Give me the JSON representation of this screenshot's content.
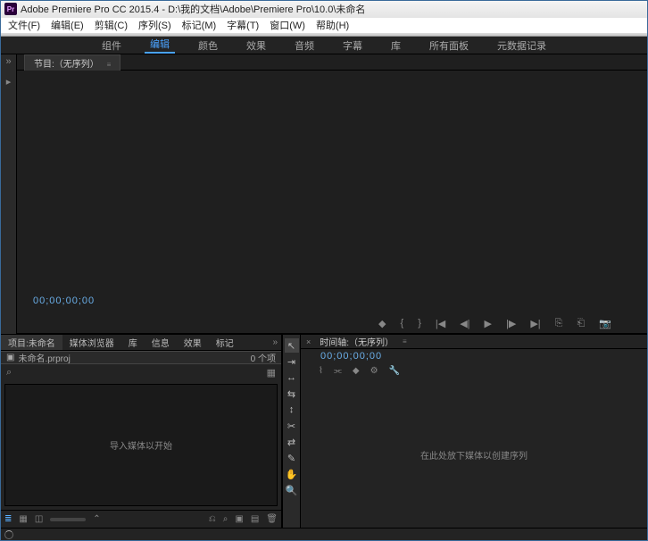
{
  "titlebar": {
    "app_icon": "Pr",
    "title": "Adobe Premiere Pro CC 2015.4 - D:\\我的文档\\Adobe\\Premiere Pro\\10.0\\未命名"
  },
  "menubar": {
    "items": [
      "文件(F)",
      "编辑(E)",
      "剪辑(C)",
      "序列(S)",
      "标记(M)",
      "字幕(T)",
      "窗口(W)",
      "帮助(H)"
    ]
  },
  "workspaces": {
    "items": [
      "组件",
      "编辑",
      "颜色",
      "效果",
      "音频",
      "字幕",
      "库",
      "所有面板",
      "元数据记录"
    ],
    "active_index": 1,
    "overflow": "»"
  },
  "program_panel": {
    "tab_label": "节目:（无序列）",
    "tab_menu_glyph": "≡",
    "timecode": "00;00;00;00",
    "controls": [
      "tag-icon",
      "in-bracket",
      "out-bracket",
      "go-start",
      "step-back",
      "play",
      "step-fwd",
      "go-end",
      "lift",
      "extract",
      "export-frame"
    ]
  },
  "left_strip": {
    "handle": "»",
    "marker": "▸"
  },
  "project_panel": {
    "tabs": [
      "项目:未命名",
      "媒体浏览器",
      "库",
      "信息",
      "效果",
      "标记"
    ],
    "active_tab": 0,
    "overflow": "»",
    "file_name": "未命名.prproj",
    "item_count": "0 个项",
    "search_glyph": "⌕",
    "folder_glyph": "▦",
    "bin_message": "导入媒体以开始",
    "footer_icons": [
      "list-view",
      "grid-view",
      "freeform",
      "zoom-slider",
      "sort",
      "find",
      "new-bin",
      "new-item",
      "trash"
    ]
  },
  "toolbar": {
    "tools": [
      {
        "name": "selection-tool",
        "glyph": "↖"
      },
      {
        "name": "track-select-tool",
        "glyph": "⇥"
      },
      {
        "name": "ripple-edit-tool",
        "glyph": "↔"
      },
      {
        "name": "rolling-edit-tool",
        "glyph": "⇆"
      },
      {
        "name": "rate-stretch-tool",
        "glyph": "↕"
      },
      {
        "name": "razor-tool",
        "glyph": "✂"
      },
      {
        "name": "slip-tool",
        "glyph": "⇄"
      },
      {
        "name": "pen-tool",
        "glyph": "✎"
      },
      {
        "name": "hand-tool",
        "glyph": "✋"
      },
      {
        "name": "zoom-tool",
        "glyph": "🔍"
      }
    ]
  },
  "timeline_panel": {
    "close_glyph": "×",
    "tab_label": "时间轴:（无序列）",
    "tab_menu_glyph": "≡",
    "timecode": "00;00;00;00",
    "icons_row": [
      "snap",
      "linked-sel",
      "add-marker",
      "seq-settings",
      "wrench"
    ],
    "body_message": "在此处放下媒体以创建序列"
  }
}
